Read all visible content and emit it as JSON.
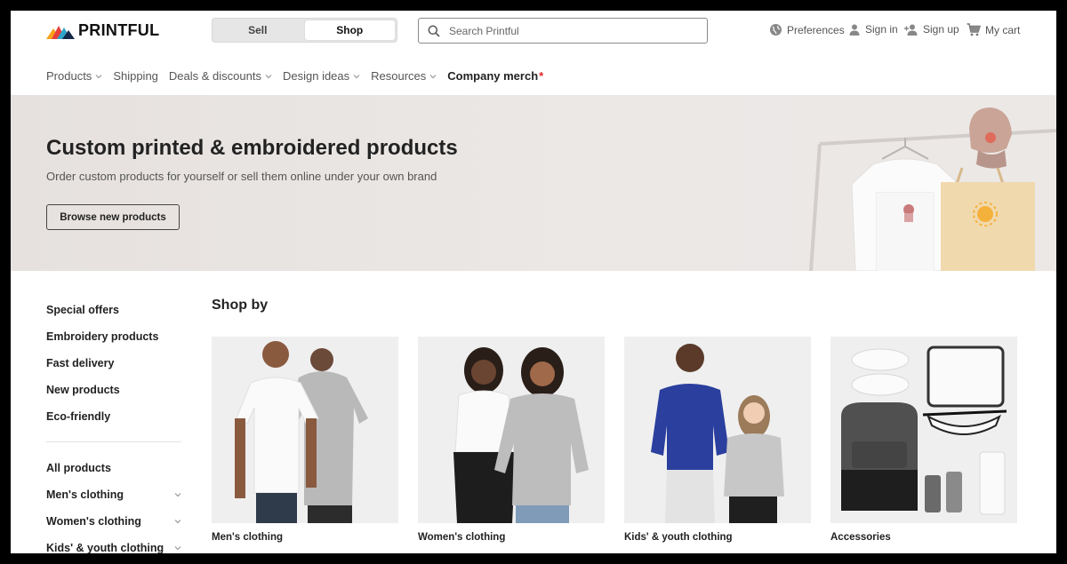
{
  "brand": {
    "name": "PRINTFUL"
  },
  "mode_switch": {
    "sell": "Sell",
    "shop": "Shop",
    "active": "Shop"
  },
  "search": {
    "placeholder": "Search Printful"
  },
  "utilities": {
    "preferences": "Preferences",
    "sign_in": "Sign in",
    "sign_up": "Sign up",
    "cart": "My cart"
  },
  "nav": {
    "items": [
      {
        "label": "Products",
        "has_dropdown": true
      },
      {
        "label": "Shipping",
        "has_dropdown": false
      },
      {
        "label": "Deals & discounts",
        "has_dropdown": true
      },
      {
        "label": "Design ideas",
        "has_dropdown": true
      },
      {
        "label": "Resources",
        "has_dropdown": true
      },
      {
        "label": "Company merch",
        "has_dropdown": false,
        "marker": "*"
      }
    ]
  },
  "hero": {
    "title": "Custom printed & embroidered products",
    "subtitle": "Order custom products for yourself or sell them online under your own brand",
    "button": "Browse new products"
  },
  "sidebar": {
    "featured": [
      "Special offers",
      "Embroidery products",
      "Fast delivery",
      "New products",
      "Eco-friendly"
    ],
    "categories": [
      {
        "label": "All products",
        "expandable": false
      },
      {
        "label": "Men's clothing",
        "expandable": true
      },
      {
        "label": "Women's clothing",
        "expandable": true
      },
      {
        "label": "Kids' & youth clothing",
        "expandable": true
      }
    ]
  },
  "shop_by": {
    "title": "Shop by",
    "cards": [
      {
        "label": "Men's clothing"
      },
      {
        "label": "Women's clothing"
      },
      {
        "label": "Kids' & youth clothing"
      },
      {
        "label": "Accessories"
      }
    ]
  },
  "colors": {
    "accent_red": "#e0282e",
    "hero_bg": "#e9e5e3",
    "text": "#222222"
  }
}
